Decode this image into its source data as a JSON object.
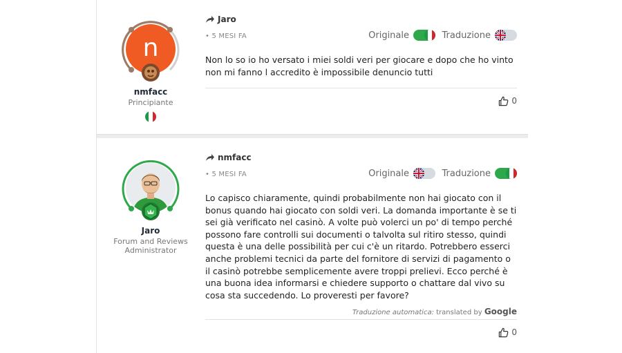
{
  "colors": {
    "toggle_on": "#2ea84a",
    "toggle_off": "#d6dbe1",
    "avatar_n_bg": "#ef5b22",
    "ring_beginner": "#9c7a63",
    "ring_admin": "#2ea84a"
  },
  "posts": [
    {
      "author": {
        "name": "nmfacc",
        "role_line1": "Principiante",
        "role_line2": "",
        "avatar_letter": "n",
        "country_flag": "italy-flag-icon"
      },
      "reply_to": "Jaro",
      "time": "• 5 MESI FA",
      "original_label": "Originale",
      "original_on": true,
      "translation_label": "Traduzione",
      "translation_on": false,
      "text": "Non lo so io ho versato i miei soldi veri per giocare e dopo che ho vinto non mi fanno l accredito è impossibile denuncio tutti",
      "likes": "0"
    },
    {
      "author": {
        "name": "Jaro",
        "role_line1": "Forum and Reviews",
        "role_line2": "Administrator",
        "avatar_letter": "",
        "country_flag": ""
      },
      "reply_to": "nmfacc",
      "time": "• 5 MESI FA",
      "original_label": "Originale",
      "original_on": false,
      "translation_label": "Traduzione",
      "translation_on": true,
      "text": "Lo capisco chiaramente, quindi probabilmente non hai giocato con il bonus quando hai giocato con soldi veri. La domanda importante è se ti sei già verificato nel casinò. A volte può volerci un po' di tempo perché possono fare controlli sui documenti o talvolta sul ritiro stesso, quindi questa è una delle possibilità per cui c'è un ritardo. Potrebbero esserci anche problemi tecnici da parte del fornitore di servizi di pagamento o il casinò potrebbe semplicemente avere troppi prelievi. Ecco perché è una buona idea informarsi e chiedere supporto o chattare dal vivo su cosa sta succedendo. Lo proveresti per favore?",
      "auto_translation_label": "Traduzione automatica:",
      "translated_by": "translated by",
      "google": "Google",
      "likes": "0"
    }
  ]
}
